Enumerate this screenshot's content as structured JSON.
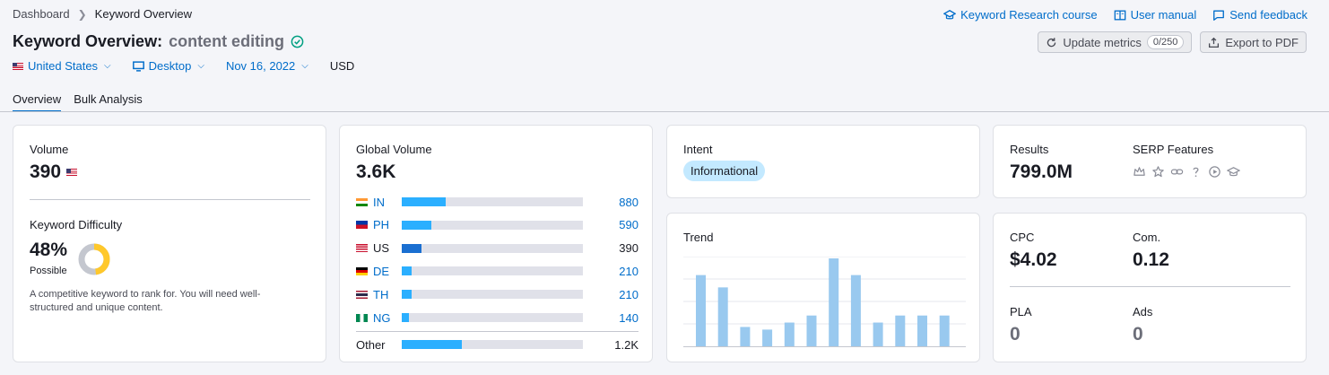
{
  "breadcrumb": {
    "root": "Dashboard",
    "current": "Keyword Overview"
  },
  "top_links": {
    "course": "Keyword Research course",
    "manual": "User manual",
    "feedback": "Send feedback"
  },
  "title": {
    "prefix": "Keyword Overview:",
    "keyword": "content editing"
  },
  "actions": {
    "update": "Update metrics",
    "counter": "0/250",
    "export": "Export to PDF"
  },
  "filters": {
    "country": "United States",
    "device": "Desktop",
    "date": "Nov 16, 2022",
    "currency": "USD"
  },
  "tabs": [
    {
      "label": "Overview"
    },
    {
      "label": "Bulk Analysis"
    }
  ],
  "volume": {
    "label": "Volume",
    "value": "390",
    "kd_label": "Keyword Difficulty",
    "kd_value": "48%",
    "kd_value_num": 48,
    "kd_status": "Possible",
    "kd_desc": "A competitive keyword to rank for. You will need well-structured and unique content."
  },
  "global": {
    "label": "Global Volume",
    "value": "3.6K",
    "rows": [
      {
        "code": "IN",
        "value": "880",
        "share": 0.245,
        "link": true
      },
      {
        "code": "PH",
        "value": "590",
        "share": 0.165,
        "link": true
      },
      {
        "code": "US",
        "value": "390",
        "share": 0.11,
        "link": false,
        "highlight": true
      },
      {
        "code": "DE",
        "value": "210",
        "share": 0.055,
        "link": true
      },
      {
        "code": "TH",
        "value": "210",
        "share": 0.055,
        "link": true
      },
      {
        "code": "NG",
        "value": "140",
        "share": 0.04,
        "link": true
      }
    ],
    "other_label": "Other",
    "other_value": "1.2K",
    "other_share": 0.33
  },
  "intent": {
    "label": "Intent",
    "badge": "Informational"
  },
  "trend": {
    "label": "Trend",
    "values": [
      0.81,
      0.67,
      0.22,
      0.19,
      0.27,
      0.35,
      1.0,
      0.81,
      0.27,
      0.35,
      0.35,
      0.35
    ]
  },
  "results": {
    "label": "Results",
    "value": "799.0M",
    "serp_label": "SERP Features"
  },
  "cpc": {
    "cpc_label": "CPC",
    "cpc_value": "$4.02",
    "com_label": "Com.",
    "com_value": "0.12",
    "pla_label": "PLA",
    "pla_value": "0",
    "ads_label": "Ads",
    "ads_value": "0"
  }
}
